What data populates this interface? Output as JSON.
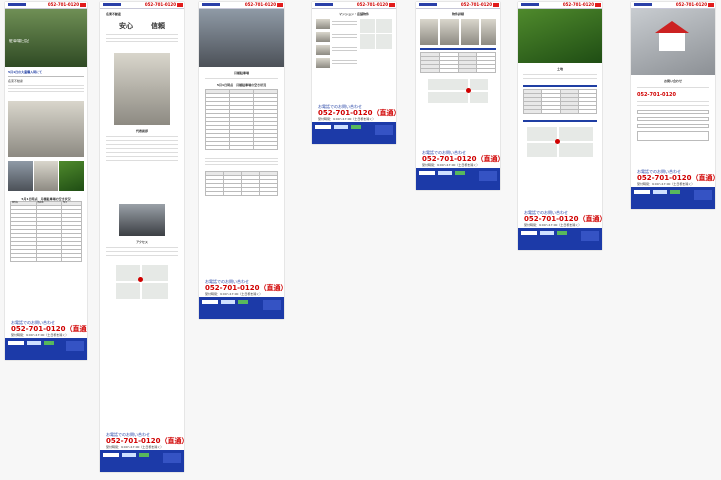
{
  "header": {
    "tel": "052-701-0120"
  },
  "pages": [
    {
      "hero_caption": "駐車場日記",
      "intro_title": "5月1日の大量購入時にて",
      "intro_text": "名東不動産",
      "section_label": "駐車場",
      "table_title": "5月1日時点　月極駐車場の空き状況",
      "table_header": [
        "物件名",
        "所在地",
        "空き"
      ]
    },
    {
      "page_title": "名東不動産",
      "headline_left": "安心",
      "headline_right": "信頼",
      "section_profile": "代表挨拶",
      "section_access": "アクセス"
    },
    {
      "section_label": "月極駐車場",
      "table_title": "5月1日時点　月極駐車場の空き状況"
    },
    {
      "section_label": "マンション・店舗物件"
    },
    {
      "section_label": "物件詳細"
    },
    {
      "section_label": "土地"
    },
    {
      "section_label": "お問い合わせ"
    }
  ],
  "contact": {
    "ask": "お電話でのお問い合わせ",
    "phone": "052-701-0120（直通）",
    "hours": "受付時間：9:00～17:00（土日祝を除く）"
  }
}
